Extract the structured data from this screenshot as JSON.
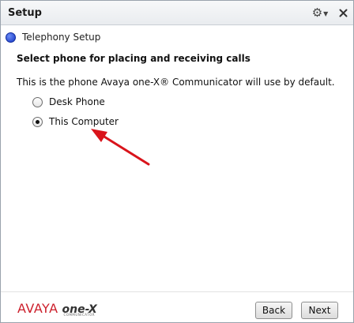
{
  "window": {
    "title": "Setup"
  },
  "step": {
    "label": "Telephony Setup"
  },
  "content": {
    "heading": "Select phone for placing and receiving calls",
    "description": "This is the phone Avaya one-X® Communicator will use by default.",
    "options": [
      {
        "label": "Desk Phone",
        "selected": false
      },
      {
        "label": "This Computer",
        "selected": true
      }
    ]
  },
  "footer": {
    "logo_brand": "AVAYA",
    "logo_product": "one-X",
    "logo_sub": "COMMUNICATOR",
    "back_label": "Back",
    "next_label": "Next"
  },
  "annotation": {
    "arrow_color": "#d9141b"
  },
  "icons": {
    "settings": "gear-icon",
    "close": "close-icon"
  }
}
